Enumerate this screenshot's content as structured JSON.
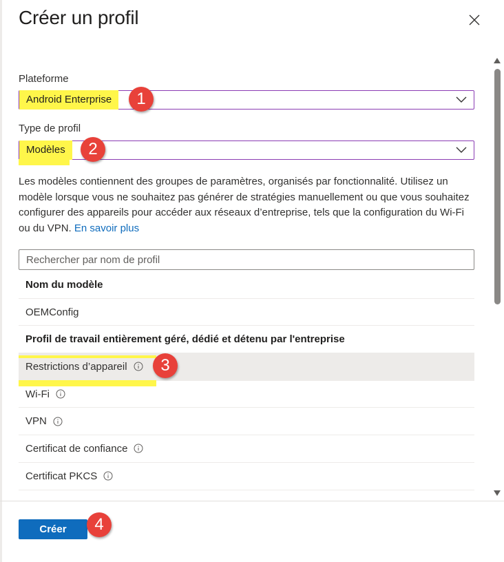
{
  "panel": {
    "title": "Créer un profil",
    "close_icon": "close-icon"
  },
  "platform": {
    "label": "Plateforme",
    "value": "Android Enterprise"
  },
  "profile_type": {
    "label": "Type de profil",
    "value": "Modèles"
  },
  "description": {
    "text": "Les modèles contiennent des groupes de paramètres, organisés par fonctionnalité. Utilisez un modèle lorsque vous ne souhaitez pas générer de stratégies manuellement ou que vous souhaitez configurer des appareils pour accéder aux réseaux d’entreprise, tels que la configuration du Wi-Fi ou du VPN.",
    "link": "En savoir plus"
  },
  "search": {
    "placeholder": "Rechercher par nom de profil"
  },
  "table": {
    "header": "Nom du modèle",
    "items_top": [
      {
        "label": "OEMConfig"
      }
    ],
    "group_label": "Profil de travail entièrement géré, dédié et détenu par l'entreprise",
    "items_group": [
      {
        "label": "Restrictions d’appareil",
        "info": true,
        "selected": true
      },
      {
        "label": "Wi-Fi",
        "info": true
      },
      {
        "label": "VPN",
        "info": true
      },
      {
        "label": "Certificat de confiance",
        "info": true
      },
      {
        "label": "Certificat PKCS",
        "info": true
      }
    ]
  },
  "footer": {
    "create_label": "Créer"
  },
  "badges": [
    "1",
    "2",
    "3",
    "4"
  ],
  "colors": {
    "highlight": "#fff64a",
    "badge": "#e8413a",
    "primary": "#0f6cbd",
    "select_border": "#8a3bb3"
  }
}
